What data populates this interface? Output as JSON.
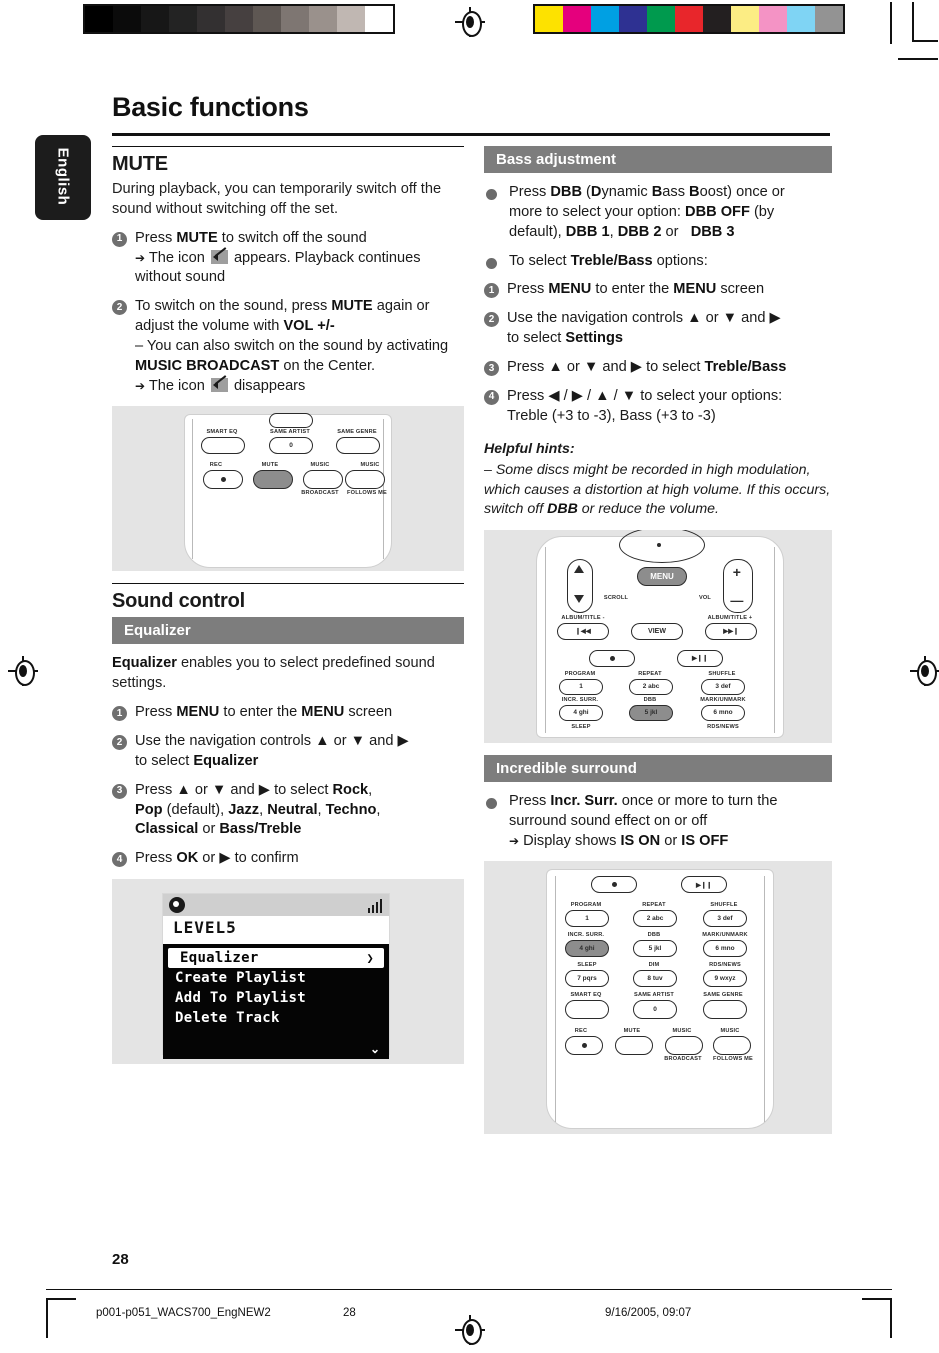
{
  "document": {
    "title": "Basic functions",
    "language_tab": "English",
    "page_number": "28"
  },
  "print_marks": {
    "grayscale_swatches": [
      "#000000",
      "#0b0b0b",
      "#171717",
      "#232323",
      "#333031",
      "#464040",
      "#5e5753",
      "#7e7672",
      "#9a918c",
      "#c0b7b2",
      "#ffffff"
    ],
    "color_swatches": [
      "#fde200",
      "#e5007d",
      "#00a0e3",
      "#2e3192",
      "#009a4e",
      "#e8262b",
      "#231f20",
      "#fced84",
      "#f493c5",
      "#7fd4f4",
      "#939393"
    ]
  },
  "left_column": {
    "mute": {
      "heading": "MUTE",
      "intro": "During playback,  you can temporarily switch off the sound without switching off the set.",
      "steps": [
        {
          "num": "1",
          "lines": [
            "Press <b>MUTE</b> to switch off the sound",
            "<span class=\"arrowglyph\">➔</span> The icon <span class=\"muteicon\" data-name=\"mute-icon\"></span> appears. Playback continues",
            "without sound"
          ]
        },
        {
          "num": "2",
          "lines": [
            "To switch on the sound, press <b>MUTE</b> again or",
            "adjust the volume with <b>VOL +/-</b>",
            "– You can also switch on the sound by activating",
            "<b>MUSIC BROADCAST</b> on the Center.",
            "<span class=\"arrowglyph\">➔</span> The icon <span class=\"muteicon\" data-name=\"mute-icon\"></span> disappears"
          ]
        }
      ],
      "image_caption": "remote control detail showing MUTE button highlighted"
    },
    "sound_control": {
      "heading": "Sound control",
      "equalizer_bar": "Equalizer",
      "intro": "<b>Equalizer</b> enables you to select predefined sound settings.",
      "steps": [
        {
          "num": "1",
          "lines": [
            "Press <b>MENU</b> to enter the <b>MENU</b> screen"
          ]
        },
        {
          "num": "2",
          "lines": [
            "Use the navigation controls  ▲  or  ▼  and ▶",
            " to select <b>Equalizer</b>"
          ]
        },
        {
          "num": "3",
          "lines": [
            "Press ▲ or ▼ and ▶ to  select <b>Rock</b>,",
            "<b>Pop</b> (default), <b>Jazz</b>,  <b>Neutral</b>, <b>Techno</b>,",
            "<b>Classical</b> or <b>Bass/Treble</b>"
          ]
        },
        {
          "num": "4",
          "lines": [
            "Press <b>OK</b> or  ▶  to confirm"
          ]
        }
      ]
    },
    "lcd": {
      "title_line": "LEVEL5",
      "items": [
        {
          "label": "Equalizer",
          "selected": true,
          "chevron": "❯"
        },
        {
          "label": "Create Playlist",
          "selected": false
        },
        {
          "label": "Add To Playlist",
          "selected": false
        },
        {
          "label": "Delete Track",
          "selected": false
        }
      ],
      "scroll_down": "⌄"
    }
  },
  "right_column": {
    "bass_adjustment": {
      "bar": "Bass adjustment",
      "bullets": [
        {
          "type": "dot",
          "lines": [
            "Press <b>DBB</b> (<b>D</b>ynamic <b>B</b>ass <b>B</b>oost) once or",
            "more to select your option: <b>DBB OFF</b> (by",
            "default), <b>DBB 1</b>, <b>DBB 2</b> or &nbsp;&nbsp;<b>DBB 3</b>"
          ]
        },
        {
          "type": "dot",
          "lines": [
            "To select <b>Treble/Bass</b> options:"
          ]
        },
        {
          "type": "num",
          "num": "1",
          "lines": [
            "Press <b>MENU</b> to enter the <b>MENU</b> screen"
          ]
        },
        {
          "type": "num",
          "num": "2",
          "lines": [
            "Use the navigation controls  ▲  or  ▼  and ▶",
            " to select <b>Settings</b>"
          ]
        },
        {
          "type": "num",
          "num": "3",
          "lines": [
            "Press ▲ or  ▼ and ▶ to  select <b>Treble/Bass</b>"
          ]
        },
        {
          "type": "num",
          "num": "4",
          "lines": [
            "Press ◀ / ▶ / ▲ / ▼  to  select  your options:",
            "Treble (+3 to -3), Bass (+3 to -3)"
          ]
        }
      ],
      "hints_heading": "Helpful hints:",
      "hints_body": "–  Some discs might be recorded in high modulation, which causes a distortion at high volume. If this occurs, switch off <b>DBB</b> or reduce the volume."
    },
    "incredible_surround": {
      "bar": "Incredible surround",
      "bullets": [
        {
          "type": "dot",
          "lines": [
            "Press <b>Incr. Surr.</b>  once or more to turn the",
            "surround sound effect on or off",
            "<span class=\"arrowglyph\">➔</span> Display shows <b>IS ON</b> or <b>IS OFF</b>"
          ]
        }
      ]
    }
  },
  "remote_keys": {
    "mute_detail": {
      "top_labels": [
        "SMART EQ",
        "SAME ARTIST",
        "SAME GENRE"
      ],
      "zero_key": "0",
      "row_labels": [
        "REC",
        "MUTE",
        "MUSIC",
        "MUSIC"
      ],
      "sub_labels": [
        "BROADCAST",
        "FOLLOWS ME"
      ],
      "highlighted": "MUTE"
    },
    "bass_detail": {
      "labels": [
        "SCROLL",
        "MENU",
        "VOL",
        "ALBUM/TITLE -",
        "VIEW",
        "ALBUM/TITLE +",
        "PROGRAM",
        "REPEAT",
        "SHUFFLE",
        "INCR. SURR.",
        "DBB",
        "MARK/UNMARK",
        "SLEEP",
        "RDS/NEWS"
      ],
      "keys": [
        "1",
        "2 abc",
        "3 def",
        "4 ghi",
        "5 jkl",
        "6 mno"
      ],
      "plus": "+",
      "minus": "–",
      "highlighted": "DBB"
    },
    "surround_detail": {
      "labels": [
        "PROGRAM",
        "REPEAT",
        "SHUFFLE",
        "INCR. SURR.",
        "DBB",
        "MARK/UNMARK",
        "SLEEP",
        "DIM",
        "RDS/NEWS",
        "SMART EQ",
        "SAME ARTIST",
        "SAME GENRE",
        "REC",
        "MUTE",
        "MUSIC",
        "MUSIC",
        "BROADCAST",
        "FOLLOWS ME"
      ],
      "keys": [
        "1",
        "2 abc",
        "3 def",
        "4 ghi",
        "5 jkl",
        "6 mno",
        "7 pqrs",
        "8 tuv",
        "9 wxyz",
        "0"
      ],
      "highlighted": "INCR. SURR."
    }
  },
  "footer": {
    "file_name": "p001-p051_WACS700_EngNEW2",
    "page": "28",
    "date": "9/16/2005, 09:07"
  },
  "colors": {
    "bar_gray": "#7d7d7d",
    "bullet_gray": "#6b6b6b",
    "image_bg": "#e4e4e4",
    "tab_black": "#1c1c1c"
  }
}
